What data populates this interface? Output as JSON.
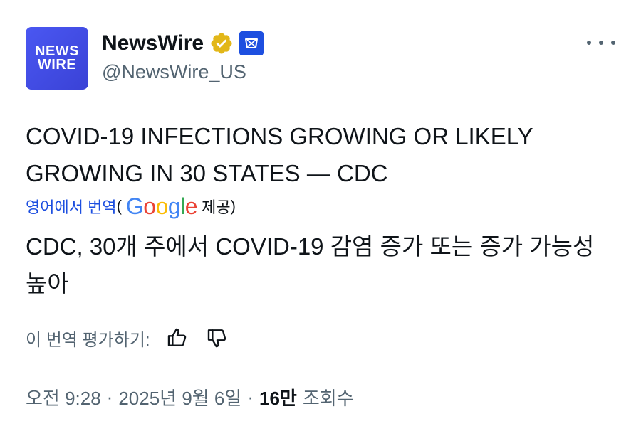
{
  "author": {
    "avatar_text_line1": "NEWS",
    "avatar_text_line2": "WIRE",
    "display_name": "NewsWire",
    "handle": "@NewsWire_US",
    "verified_badge_icon": "gold-verified-check-icon",
    "affiliate_icon": "affiliate-badge-icon",
    "brand_color": "#3e49e2",
    "verified_color": "#e2b719"
  },
  "more_menu_icon": "more-dots-icon",
  "tweet": {
    "text": "COVID-19 INFECTIONS GROWING OR LIKELY GROWING IN 30 STATES — CDC"
  },
  "translation": {
    "label": "영어에서 번역",
    "paren_open": "(",
    "provider": "Google",
    "provided": "제공",
    "paren_close": ")",
    "text": "CDC, 30개 주에서 COVID-19 감염 증가 또는 증가 가능성 높아"
  },
  "rate": {
    "label": "이 번역 평가하기:",
    "thumbs_up_icon": "thumbs-up-icon",
    "thumbs_down_icon": "thumbs-down-icon"
  },
  "meta": {
    "time": "오전 9:28",
    "sep1": "·",
    "date": "2025년 9월 6일",
    "sep2": "·",
    "views_count": "16만",
    "views_label": "조회수"
  },
  "colors": {
    "link": "#1d4fe0",
    "secondary_text": "#536471",
    "primary_text": "#0f1419"
  }
}
